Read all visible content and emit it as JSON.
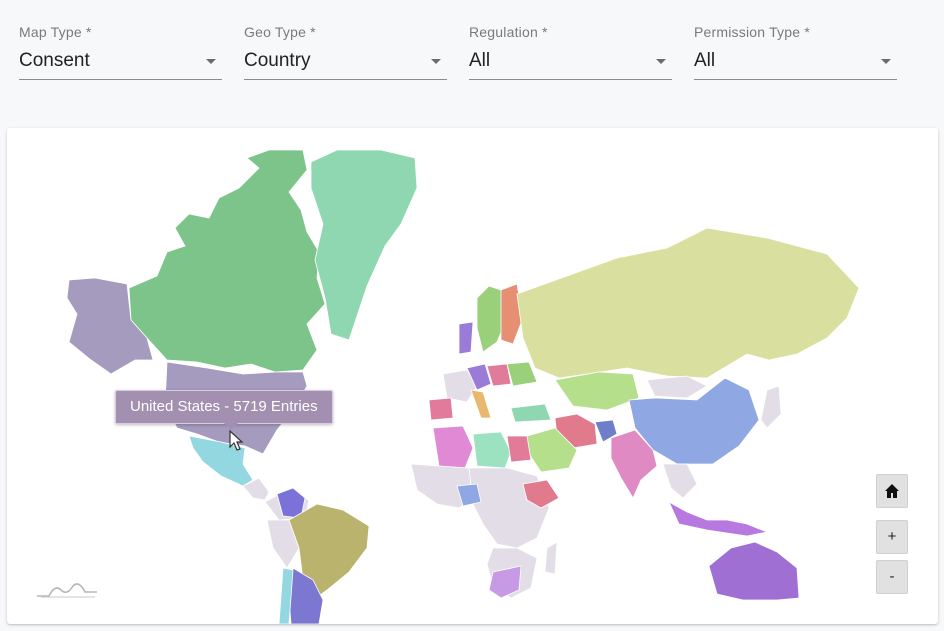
{
  "filters": [
    {
      "label": "Map Type *",
      "value": "Consent"
    },
    {
      "label": "Geo Type *",
      "value": "Country"
    },
    {
      "label": "Regulation *",
      "value": "All"
    },
    {
      "label": "Permission Type *",
      "value": "All"
    }
  ],
  "map": {
    "tooltip": "United States - 5719 Entries",
    "controls": {
      "home_icon": "home-icon",
      "zoom_in": "+",
      "zoom_out": "-"
    },
    "colors": {
      "canada": "#7cc48a",
      "greenland": "#8fd7b0",
      "usa": "#a59bbe",
      "mexico": "#93d8e0",
      "brazil": "#b9b36e",
      "russia": "#d8df9f",
      "china": "#8fa7e2",
      "india": "#e08ac4",
      "australia": "#9f6fd4",
      "default": "#e2dde6"
    }
  }
}
